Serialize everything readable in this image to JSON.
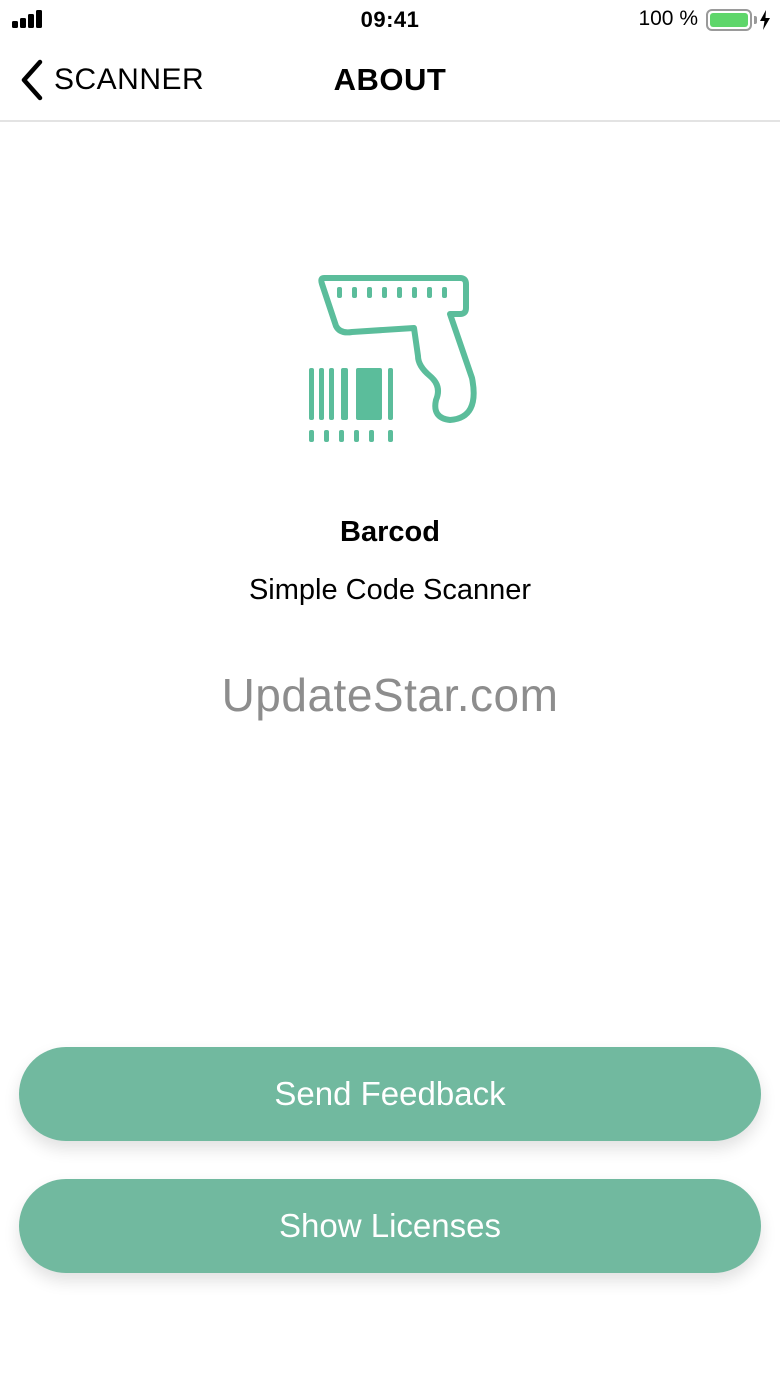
{
  "status_bar": {
    "time": "09:41",
    "battery_percent": "100 %",
    "battery_level": 1.0,
    "signal_bars": 4,
    "battery_color": "#5fd66b",
    "charging": true
  },
  "nav": {
    "back_label": "SCANNER",
    "title": "ABOUT"
  },
  "about": {
    "logo_icon": "barcode-scanner-icon",
    "app_name": "Barcod",
    "subtitle": "Simple Code Scanner",
    "watermark": "UpdateStar.com"
  },
  "actions": {
    "feedback_label": "Send Feedback",
    "licenses_label": "Show Licenses"
  },
  "colors": {
    "accent": "#71b99f",
    "logo": "#5bbd9b"
  }
}
